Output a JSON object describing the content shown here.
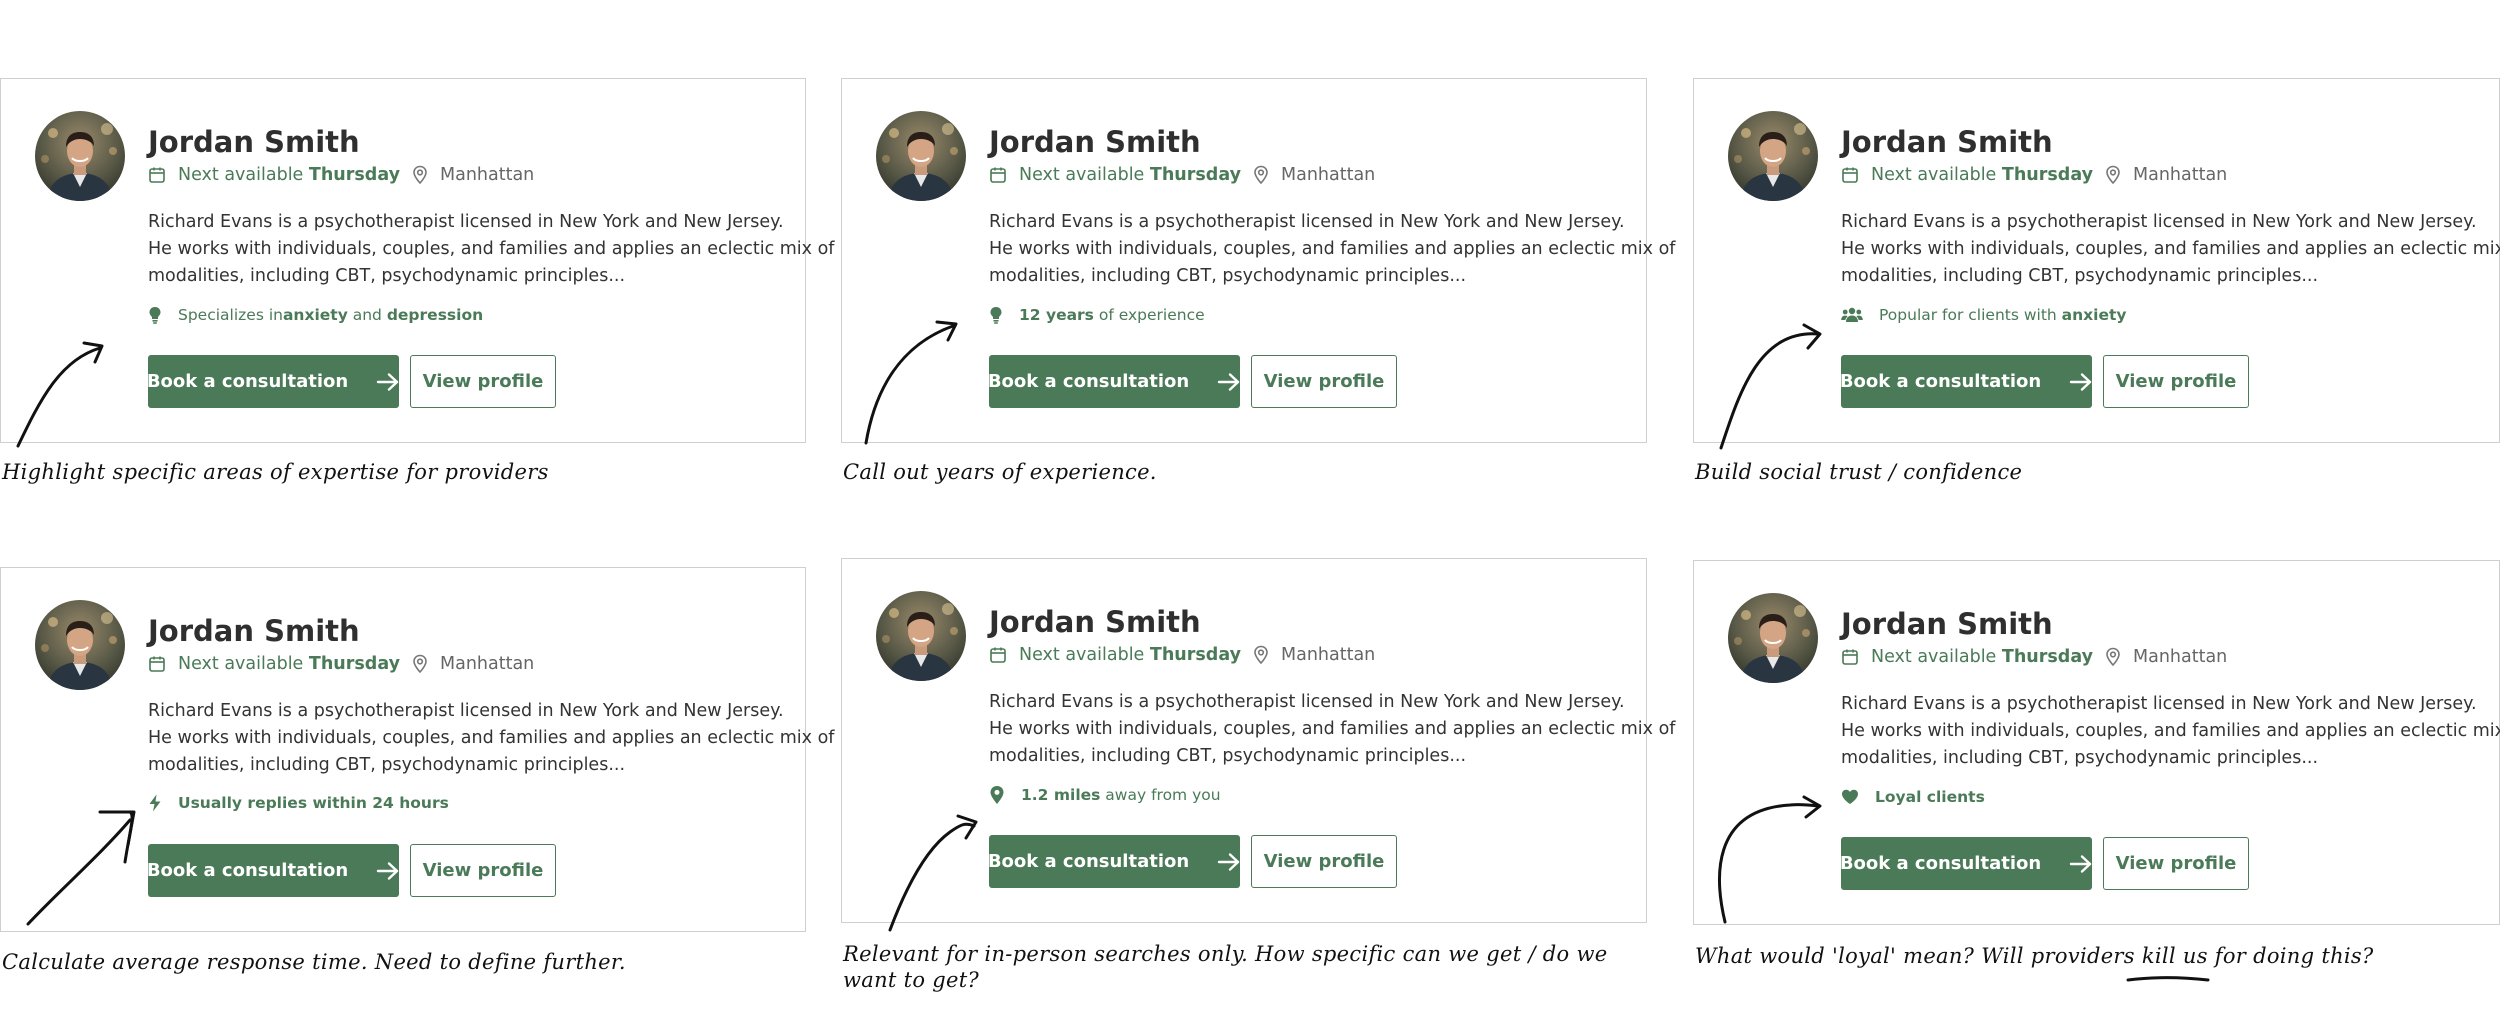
{
  "colors": {
    "accent": "#4a7a57",
    "border": "#cfcfcf",
    "text": "#333333"
  },
  "cards": [
    {
      "name": "Jordan Smith",
      "availability": {
        "prefix": "Next available ",
        "day": "Thursday"
      },
      "location": "Manhattan",
      "bio": [
        "Richard Evans is a psychotherapist licensed in New York and New Jersey.",
        "He works with individuals, couples, and families and applies an eclectic mix of",
        "modalities, including CBT, psychodynamic principles..."
      ],
      "feature": {
        "icon": "lightbulb-icon",
        "parts": [
          "Specializes in ",
          "anxiety",
          " and ",
          "depression"
        ]
      },
      "book_label": "Book a consultation",
      "view_label": "View profile",
      "note": "Highlight specific areas of expertise for providers"
    },
    {
      "name": "Jordan Smith",
      "availability": {
        "prefix": "Next available ",
        "day": "Thursday"
      },
      "location": "Manhattan",
      "bio": [
        "Richard Evans is a psychotherapist licensed in New York and New Jersey.",
        "He works with individuals, couples, and families and applies an eclectic mix of",
        "modalities, including CBT, psychodynamic principles..."
      ],
      "feature": {
        "icon": "lightbulb-icon",
        "parts": [
          "12 years",
          " of experience"
        ]
      },
      "book_label": "Book a consultation",
      "view_label": "View profile",
      "note": "Call out years of experience."
    },
    {
      "name": "Jordan Smith",
      "availability": {
        "prefix": "Next available ",
        "day": "Thursday"
      },
      "location": "Manhattan",
      "bio": [
        "Richard Evans is a psychotherapist licensed in New York and New Jersey.",
        "He works with individuals, couples, and families and applies an eclectic mix of",
        "modalities, including CBT, psychodynamic principles..."
      ],
      "feature": {
        "icon": "users-icon",
        "parts": [
          "Popular for clients with ",
          "anxiety"
        ]
      },
      "book_label": "Book a consultation",
      "view_label": "View profile",
      "note": "Build social trust / confidence"
    },
    {
      "name": "Jordan Smith",
      "availability": {
        "prefix": "Next available ",
        "day": "Thursday"
      },
      "location": "Manhattan",
      "bio": [
        "Richard Evans is a psychotherapist licensed in New York and New Jersey.",
        "He works with individuals, couples, and families and applies an eclectic mix of",
        "modalities, including CBT, psychodynamic principles..."
      ],
      "feature": {
        "icon": "lightning-icon",
        "parts": [
          "Usually replies within 24 hours"
        ]
      },
      "book_label": "Book a consultation",
      "view_label": "View profile",
      "note": "Calculate average response time. Need to define further."
    },
    {
      "name": "Jordan Smith",
      "availability": {
        "prefix": "Next available ",
        "day": "Thursday"
      },
      "location": "Manhattan",
      "bio": [
        "Richard Evans is a psychotherapist licensed in New York and New Jersey.",
        "He works with individuals, couples, and families and applies an eclectic mix of",
        "modalities, including CBT, psychodynamic principles..."
      ],
      "feature": {
        "icon": "map-pin-icon",
        "parts": [
          "1.2 miles",
          " away from you"
        ]
      },
      "book_label": "Book a consultation",
      "view_label": "View profile",
      "note_lines": [
        "Relevant for in-person searches only. How specific can we get / do we",
        "want to get?"
      ]
    },
    {
      "name": "Jordan Smith",
      "availability": {
        "prefix": "Next available ",
        "day": "Thursday"
      },
      "location": "Manhattan",
      "bio": [
        "Richard Evans is a psychotherapist licensed in New York and New Jersey.",
        "He works with individuals, couples, and families and applies an eclectic mix of",
        "modalities, including CBT, psychodynamic principles..."
      ],
      "feature": {
        "icon": "heart-icon",
        "parts": [
          "Loyal clients"
        ]
      },
      "book_label": "Book a consultation",
      "view_label": "View profile",
      "note": "What would 'loyal' mean? Will providers kill us for doing this?"
    }
  ]
}
